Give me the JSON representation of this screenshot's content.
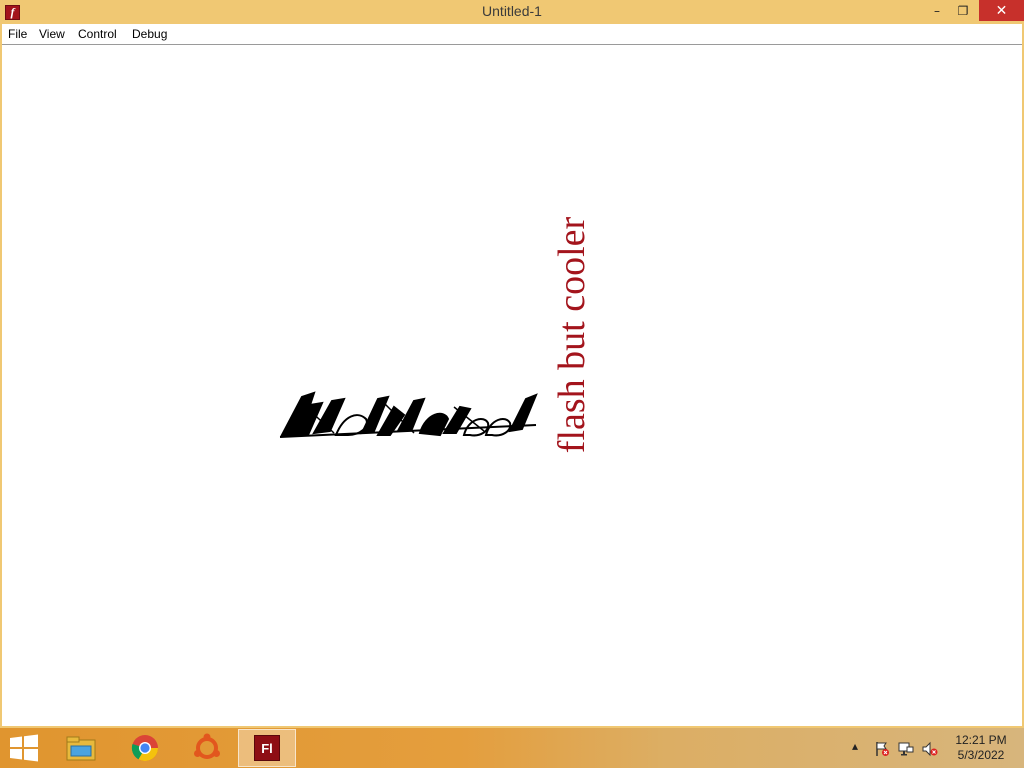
{
  "window": {
    "title": "Untitled-1",
    "app_icon": "flash-player-icon",
    "controls": {
      "minimize": "–",
      "maximize": "❐",
      "close": "✕"
    }
  },
  "menubar": {
    "items": [
      "File",
      "View",
      "Control",
      "Debug"
    ]
  },
  "stage": {
    "rotated_text": "flash but cooler",
    "text_color": "#a3141c"
  },
  "taskbar": {
    "apps": [
      "file-explorer-icon",
      "chrome-icon",
      "ubuntu-icon",
      "flash-icon"
    ],
    "flash_label": "Fl",
    "tray_chevron": "▴",
    "clock": {
      "time": "12:21 PM",
      "date": "5/3/2022"
    }
  },
  "colors": {
    "titlebar": "#f0c873",
    "close_button": "#c7302b",
    "flash_red": "#a3141c"
  }
}
